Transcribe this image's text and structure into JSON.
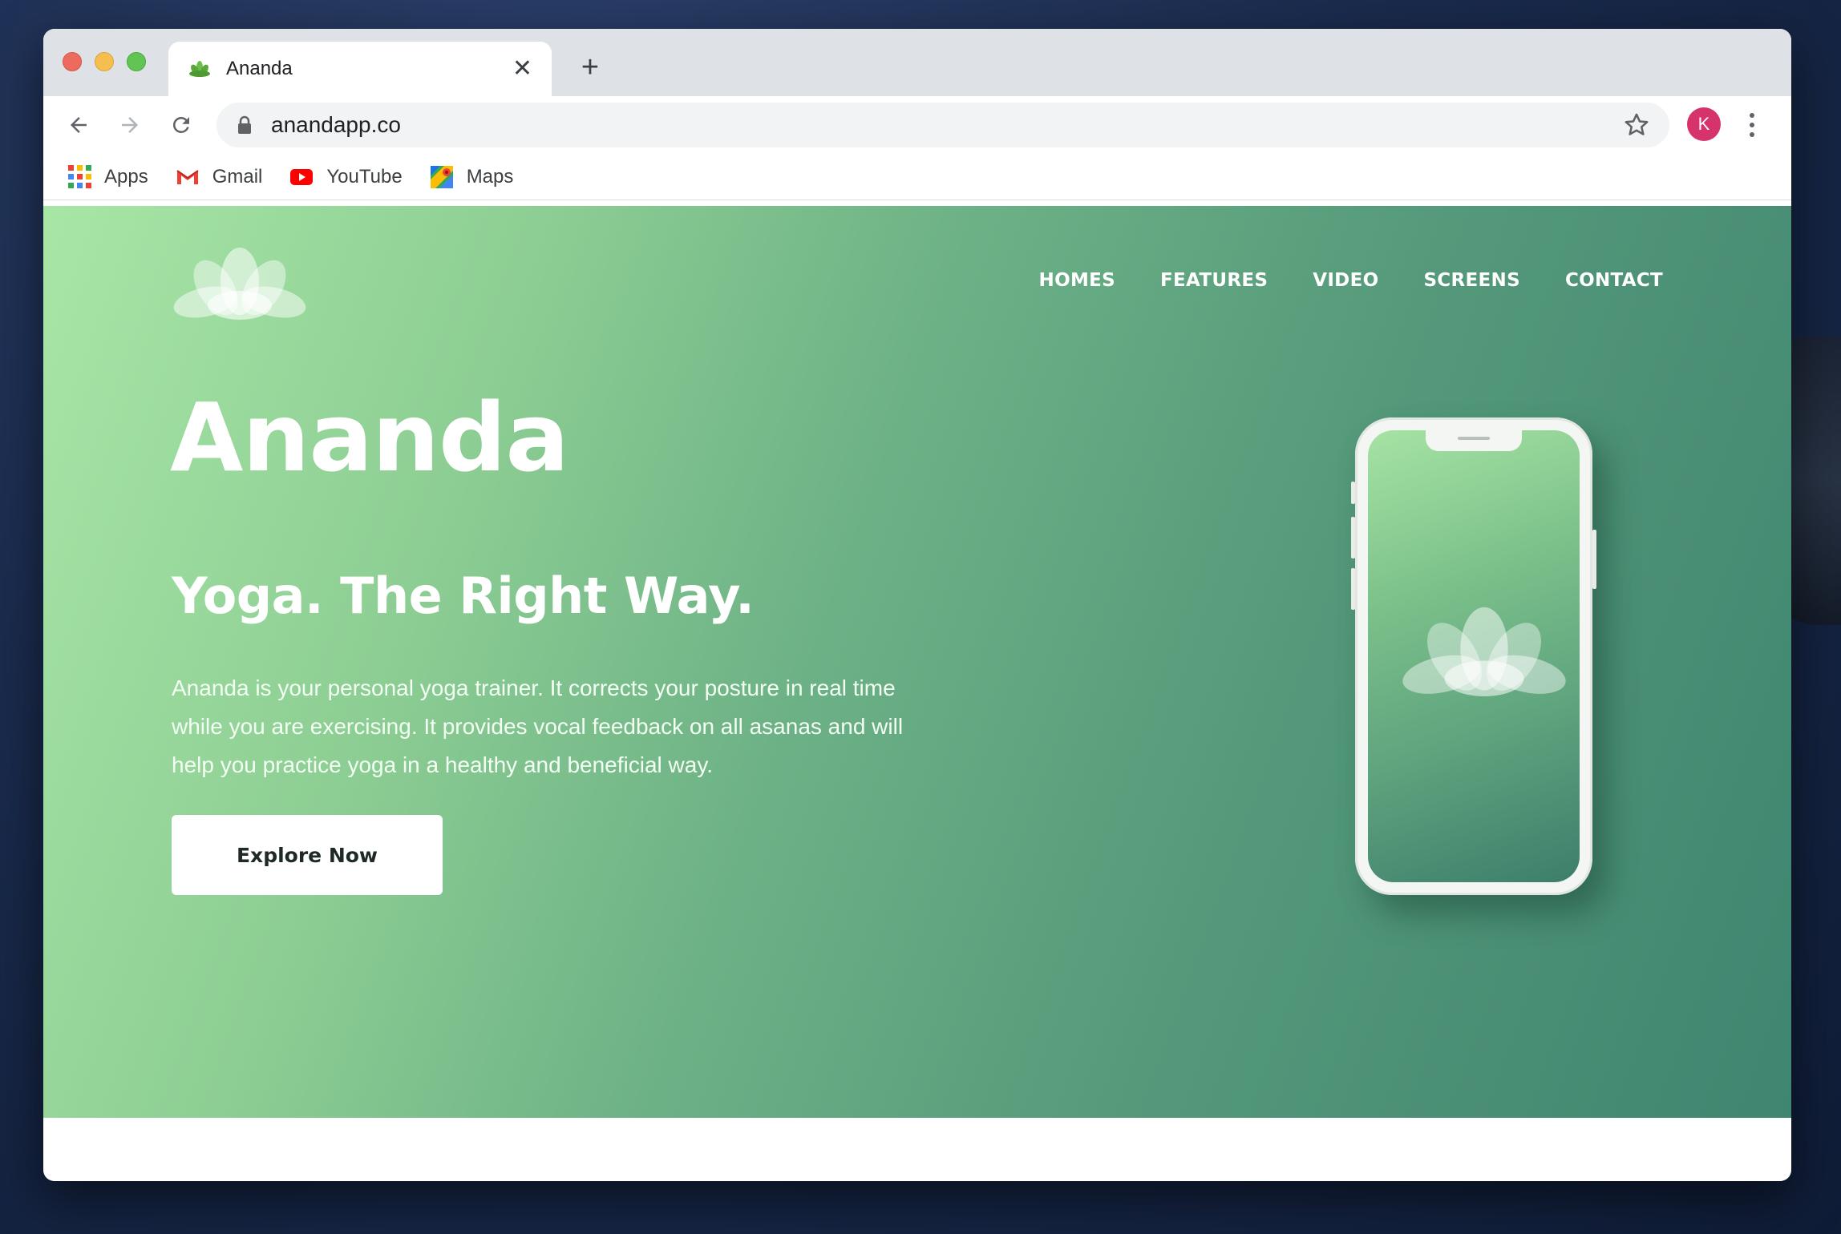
{
  "browser": {
    "tab_title": "Ananda",
    "new_tab_symbol": "+",
    "tab_close_symbol": "✕",
    "url": "anandapp.co",
    "profile_initial": "K",
    "profile_color": "#d6336c"
  },
  "bookmarks": [
    {
      "label": "Apps",
      "icon": "apps-grid-icon"
    },
    {
      "label": "Gmail",
      "icon": "gmail-icon"
    },
    {
      "label": "YouTube",
      "icon": "youtube-icon"
    },
    {
      "label": "Maps",
      "icon": "maps-icon"
    }
  ],
  "site": {
    "nav": [
      "HOMES",
      "FEATURES",
      "VIDEO",
      "SCREENS",
      "CONTACT"
    ],
    "title": "Ananda",
    "subtitle": "Yoga. The Right Way.",
    "description": "Ananda is your personal yoga trainer. It corrects your posture in real time while you are exercising. It provides vocal feedback on all asanas and will help you practice yoga in a healthy and beneficial way.",
    "cta_label": "Explore Now",
    "logo_icon": "lotus-icon",
    "gradient_start": "#a8e6a6",
    "gradient_end": "#3f8570"
  }
}
